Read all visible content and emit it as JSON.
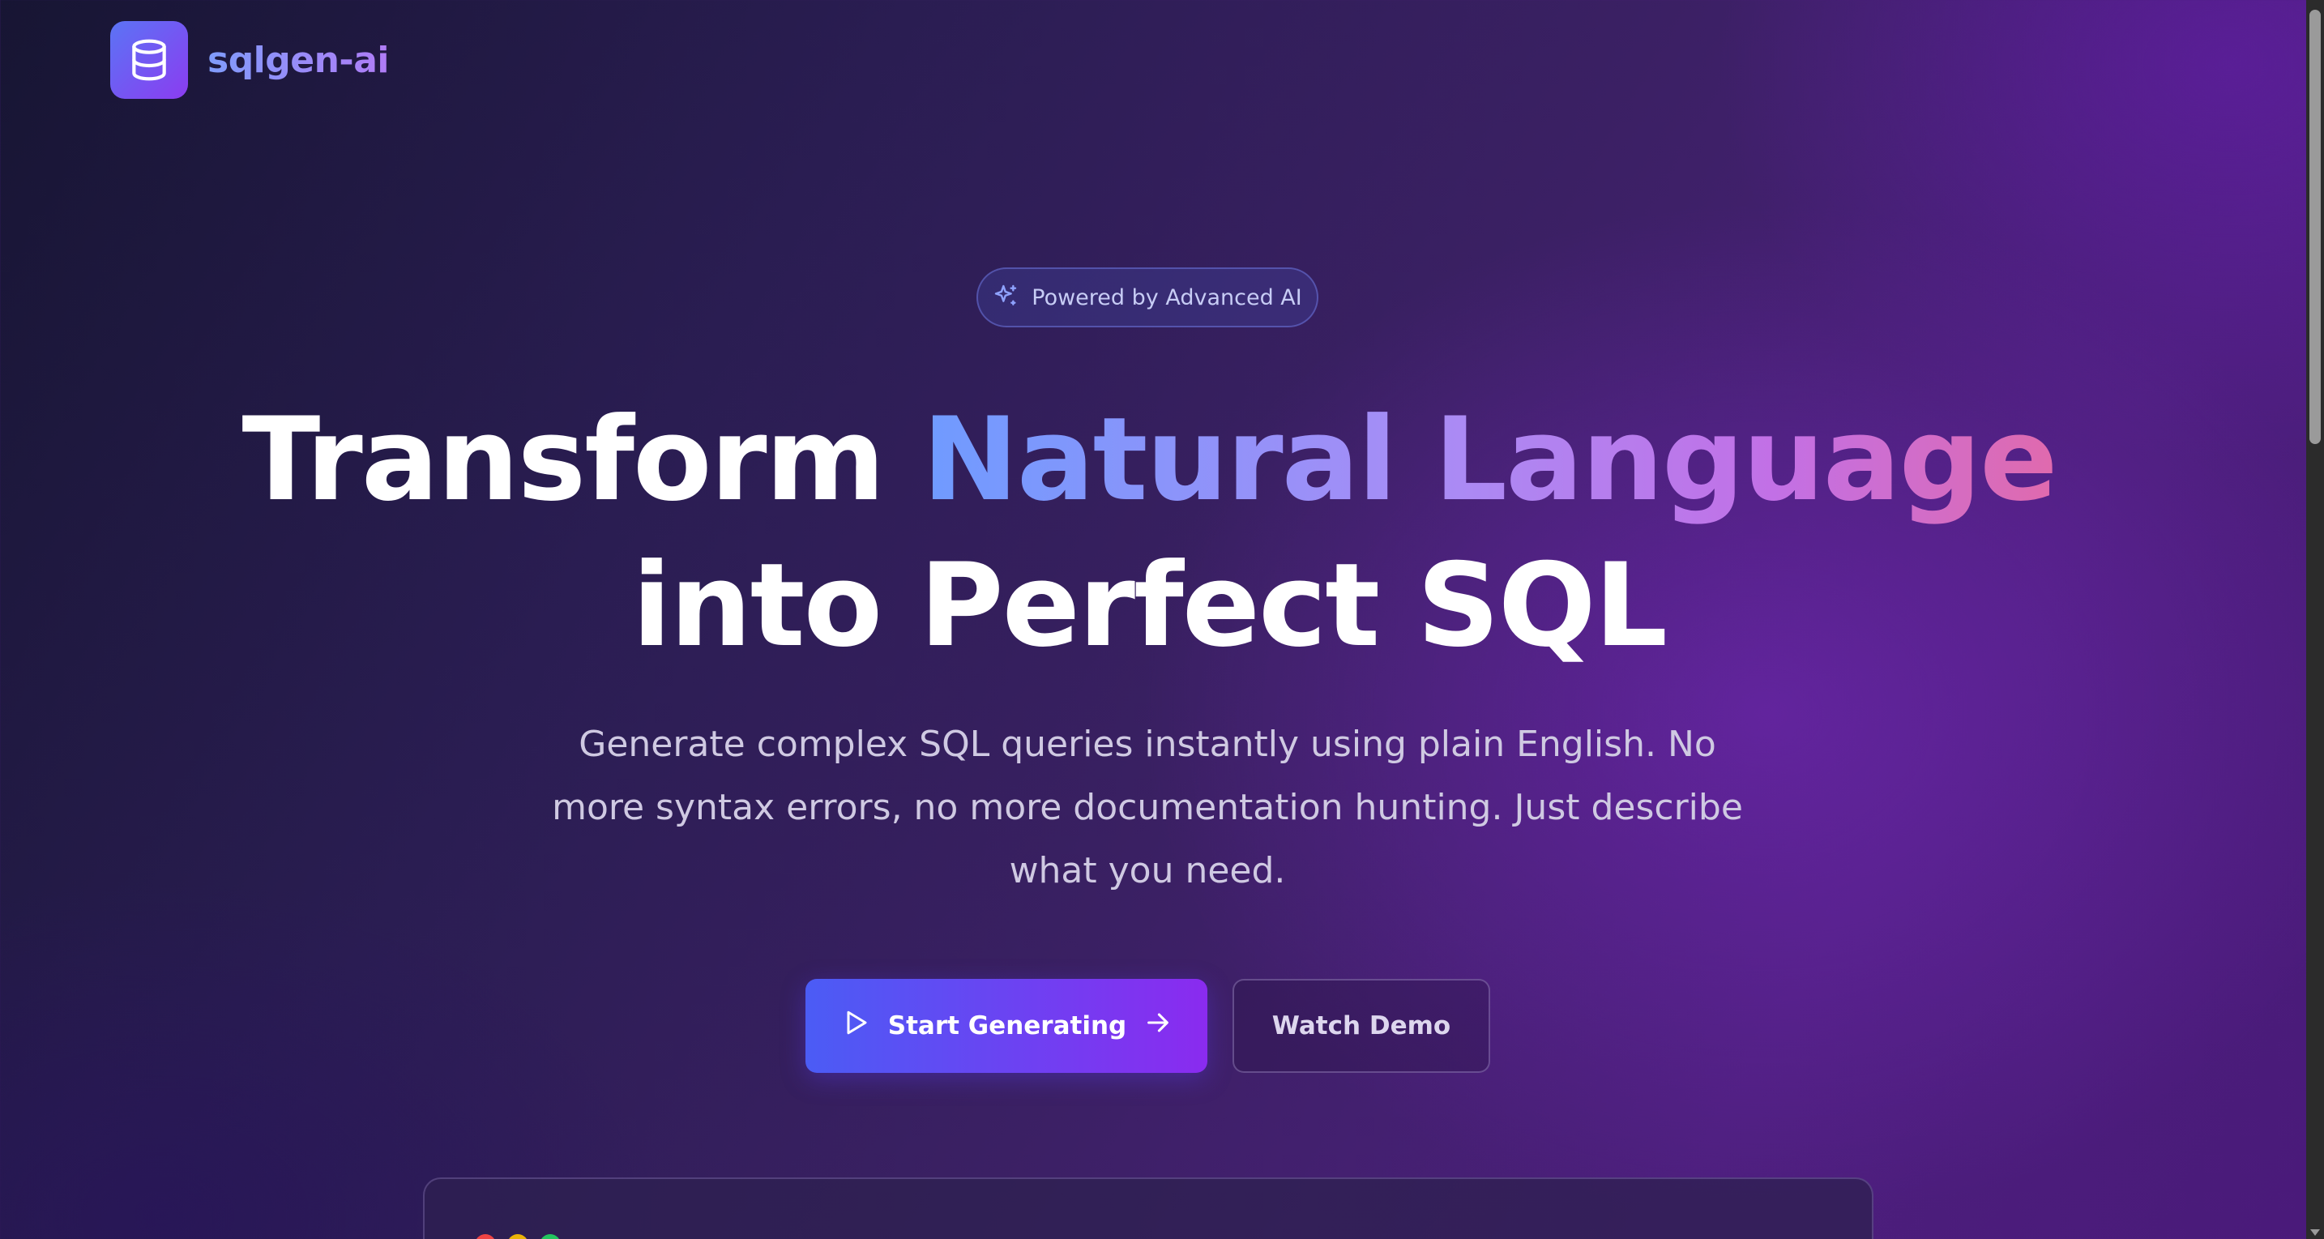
{
  "brand": {
    "name": "sqlgen-ai",
    "logo_icon": "database-icon"
  },
  "hero": {
    "badge": {
      "icon": "sparkles-icon",
      "text": "Powered by Advanced AI"
    },
    "headline": {
      "part1": "Transform ",
      "highlight": "Natural Language",
      "part2": "into Perfect SQL"
    },
    "subtitle": "Generate complex SQL queries instantly using plain English. No more syntax errors, no more documentation hunting. Just describe what you need.",
    "primary_button": {
      "label": "Start Generating",
      "icon_left": "play-icon",
      "icon_right": "arrow-right-icon"
    },
    "secondary_button": {
      "label": "Watch Demo"
    }
  },
  "preview": {
    "window_dots": [
      "#ef4444",
      "#eab308",
      "#22c55e"
    ]
  },
  "colors": {
    "accent_start": "#4b5cf5",
    "accent_end": "#8a2bef",
    "gradient_text_start": "#6f9bff",
    "gradient_text_end": "#e06aad"
  }
}
